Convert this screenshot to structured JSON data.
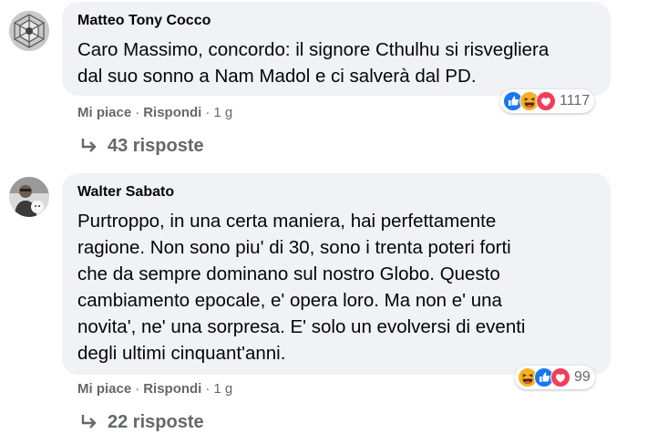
{
  "comments": [
    {
      "author": "Matteo Tony Cocco",
      "lines": [
        "Caro Massimo, concordo: il signore Cthulhu si risvegliera",
        "dal suo sonno a Nam Madol e ci salverà dal PD."
      ],
      "like_label": "Mi piace",
      "reply_label": "Rispondi",
      "time": "1 g",
      "reactions": [
        "like-icon",
        "haha-icon",
        "love-icon"
      ],
      "reaction_count": "1117",
      "replies_label": "43 risposte"
    },
    {
      "author": "Walter Sabato",
      "lines": [
        "Purtroppo, in una certa maniera, hai perfettamente",
        "ragione. Non sono piu' di 30, sono i trenta poteri forti",
        "che da sempre dominano sul nostro Globo. Questo",
        "cambiamento epocale, e' opera loro. Ma non e' una",
        "novita', ne' una sorpresa. E' solo un evolversi di eventi",
        "degli ultimi cinquant'anni."
      ],
      "like_label": "Mi piace",
      "reply_label": "Rispondi",
      "time": "1 g",
      "reactions": [
        "haha-icon",
        "like-icon",
        "love-icon"
      ],
      "reaction_count": "99",
      "replies_label": "22 risposte"
    }
  ],
  "separator": "·",
  "colors": {
    "bubble": "#f0f2f5",
    "meta_text": "#65676b",
    "like": "#1877f2",
    "love": "#f33e58",
    "haha": "#f7b125"
  }
}
